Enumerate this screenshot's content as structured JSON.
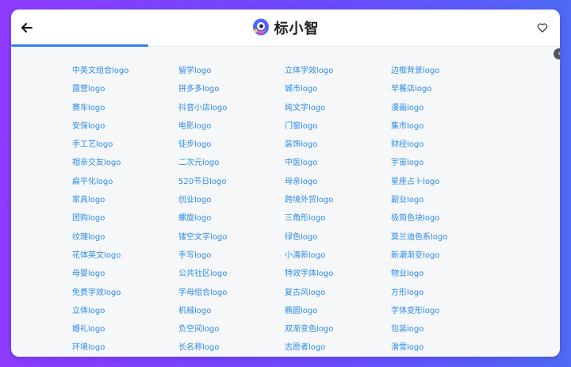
{
  "brand": {
    "title": "标小智"
  },
  "progress": {
    "fraction": 0.25
  },
  "links": [
    "中英文组合logo",
    "留学logo",
    "立体字效logo",
    "边框背景logo",
    "露营logo",
    "拼多多logo",
    "城市logo",
    "早餐店logo",
    "赛车logo",
    "抖音小店logo",
    "纯文字logo",
    "漫画logo",
    "安保logo",
    "电影logo",
    "门窗logo",
    "集市logo",
    "手工艺logo",
    "徒步logo",
    "装饰logo",
    "财经logo",
    "相亲交友logo",
    "二次元logo",
    "中医logo",
    "宇宙logo",
    "扁平化logo",
    "520节日logo",
    "母亲logo",
    "星座占卜logo",
    "家具logo",
    "创业logo",
    "跨境外贸logo",
    "副业logo",
    "团购logo",
    "螺旋logo",
    "三角形logo",
    "极简色块logo",
    "纹理logo",
    "镂空文字logo",
    "绿色logo",
    "莫兰迪色系logo",
    "花体英文logo",
    "手写logo",
    "小清新logo",
    "新潮渐变logo",
    "母婴logo",
    "公共社区logo",
    "特效字体logo",
    "物业logo",
    "免费字效logo",
    "字母组合logo",
    "复古风logo",
    "方形logo",
    "立体logo",
    "机械logo",
    "椭圆logo",
    "字体变形logo",
    "婚礼logo",
    "负空间logo",
    "双渐变色logo",
    "包装logo",
    "环境logo",
    "长名称logo",
    "志愿者logo",
    "滑雪logo"
  ],
  "colors": {
    "accent": "#2f7df6",
    "link": "#2b8be8",
    "header_bg": "#ffffff",
    "content_bg": "#f6f7f9"
  }
}
